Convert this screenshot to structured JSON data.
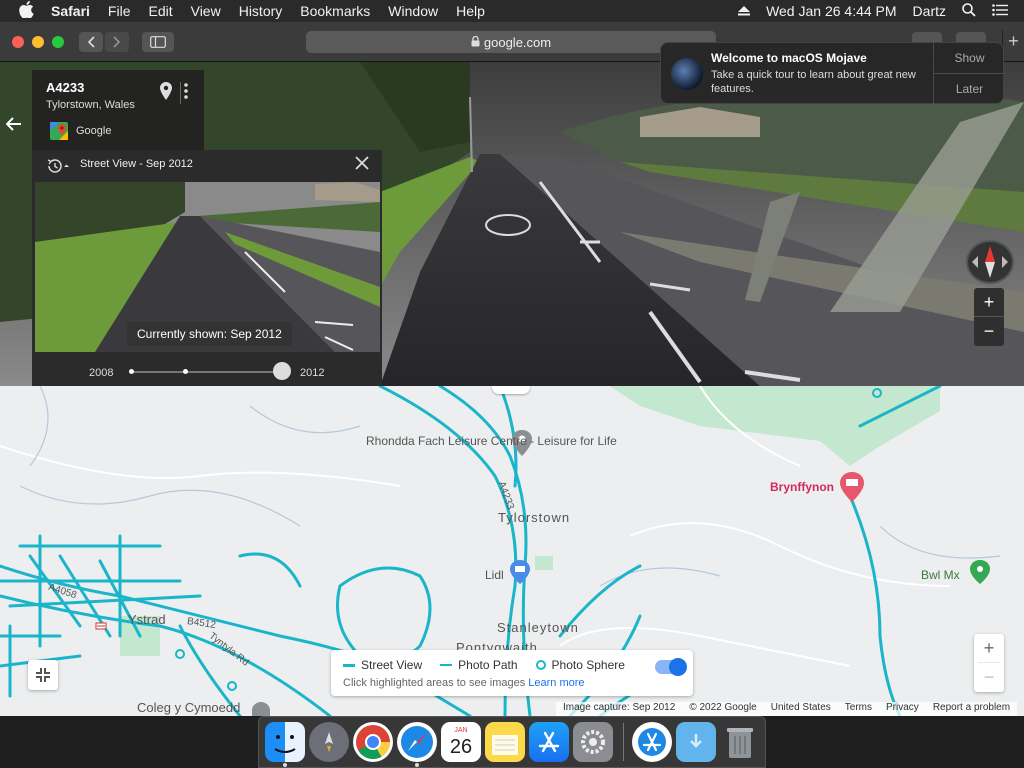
{
  "menubar": {
    "app_name": "Safari",
    "items": [
      "File",
      "Edit",
      "View",
      "History",
      "Bookmarks",
      "Window",
      "Help"
    ],
    "clock": "Wed Jan 26  4:44 PM",
    "user": "Dartz"
  },
  "toolbar": {
    "url": "google.com"
  },
  "notification": {
    "title": "Welcome to macOS Mojave",
    "body": "Take a quick tour to learn about great new features.",
    "show_label": "Show",
    "later_label": "Later"
  },
  "street_view": {
    "place_title": "A4233",
    "place_subtitle": "Tylorstown, Wales",
    "provider": "Google",
    "time_machine": {
      "header": "Street View - Sep 2012",
      "currently_shown": "Currently shown: Sep 2012",
      "year_start": "2008",
      "year_end": "2012",
      "selected_year": 2012
    }
  },
  "map": {
    "labels": {
      "leisure": "Rhondda Fach Leisure Centre - Leisure for Life",
      "road_a4233": "A4233",
      "tylorstown": "Tylorstown",
      "brynffynon": "Brynffynon",
      "lidl": "Lidl",
      "bwl": "Bwl Mx",
      "ystrad": "Ystrad",
      "b4512": "B4512",
      "a4058": "A4058",
      "tyntyla": "Tyntyla Rd",
      "stanleytown": "Stanleytown",
      "pontygwaith": "Pontygwaith",
      "coleg": "Coleg y Cymoedd"
    },
    "legend": {
      "street_view": "Street View",
      "photo_path": "Photo Path",
      "photo_sphere": "Photo Sphere",
      "hint": "Click highlighted areas to see images",
      "learn_more": "Learn more",
      "toggle_on": true
    },
    "attribution": [
      "Image capture: Sep 2012",
      "© 2022 Google",
      "United States",
      "Terms",
      "Privacy",
      "Report a problem"
    ]
  },
  "dock": {
    "apps": [
      "finder-icon",
      "launchpad-icon",
      "chrome-icon",
      "safari-icon",
      "calendar-icon",
      "notes-icon",
      "app-store-icon",
      "system-preferences-icon",
      "app-store-folder-icon",
      "downloads-folder-icon",
      "trash-icon"
    ],
    "calendar_month": "JAN",
    "calendar_day": "26"
  },
  "colors": {
    "streetview_blue": "#1ab5c9",
    "accent_blue": "#1a73e8",
    "poi_pink": "#d02b5f"
  }
}
